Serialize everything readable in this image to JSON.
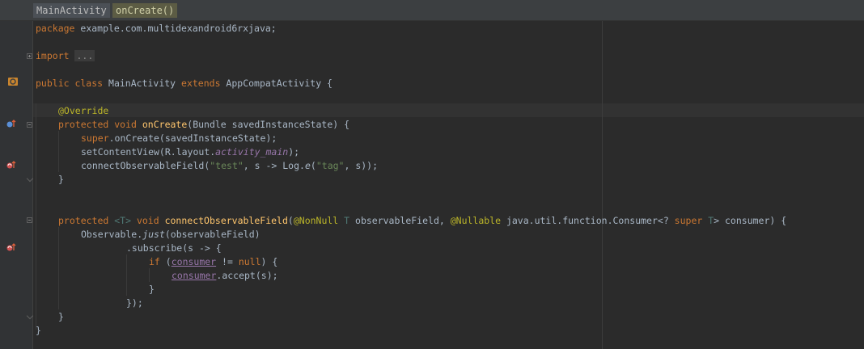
{
  "breadcrumb": {
    "items": [
      "MainActivity",
      "onCreate()"
    ]
  },
  "code": {
    "l1": {
      "kw": "package",
      "rest": " example.com.multidexandroid6rxjava;"
    },
    "l2": {
      "kw": "import",
      "folded": "..."
    },
    "l3": {
      "kw1": "public class",
      "name": " MainActivity ",
      "kw2": "extends",
      "rest": " AppCompatActivity {"
    },
    "l4": {
      "ann": "@Override"
    },
    "l5": {
      "kw": "protected void",
      "fn": "onCreate",
      "rest": "(Bundle savedInstanceState) {"
    },
    "l6": {
      "kw": "super",
      "rest": ".onCreate(savedInstanceState);"
    },
    "l7": {
      "a": "setContentView(R.layout.",
      "field": "activity_main",
      "b": ");"
    },
    "l8": {
      "a": "connectObservableField(",
      "s1": "\"test\"",
      "b": ", s -> Log.",
      "m": "e",
      "c": "(",
      "s2": "\"tag\"",
      "d": ", s));"
    },
    "l9": "}",
    "l10": {
      "kw1": "protected",
      "gen1": "<T>",
      "kw2": " void ",
      "fn": "connectObservableField",
      "p1": "(",
      "ann1": "@NonNull",
      "t1": " T",
      "p2": " observableField, ",
      "ann2": "@Nullable",
      "p3": " java.util.function.Consumer<? ",
      "kw3": "super",
      "t2": " T",
      "p4": "> consumer) {"
    },
    "l11": {
      "a": "Observable.",
      "m": "just",
      "b": "(observableField)"
    },
    "l12": ".subscribe(s -> {",
    "l13": {
      "kw": "if",
      "a": " (",
      "u": "consumer",
      "b": " != ",
      "kw2": "null",
      "c": ") {"
    },
    "l14": {
      "u": "consumer",
      "a": ".accept(s);"
    },
    "l15": "}",
    "l16": "});",
    "l17": "}",
    "l18": "}"
  },
  "gutter_icons": [
    "class-icon",
    "override-icon",
    "recursion-icon",
    "recursion-icon"
  ],
  "colors": {
    "background": "#2b2b2b",
    "keyword": "#cc7832",
    "annotation": "#bbb529",
    "string": "#6a8759",
    "method": "#ffc66d",
    "field": "#9876aa"
  }
}
